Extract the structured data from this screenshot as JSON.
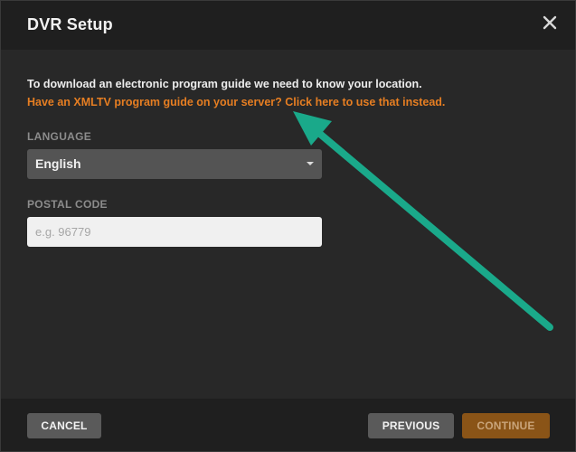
{
  "dialog": {
    "title": "DVR Setup",
    "close_icon": "close-x-icon"
  },
  "body": {
    "intro_text": "To download an electronic program guide we need to know your location.",
    "xmltv_link_text": "Have an XMLTV program guide on your server? Click here to use that instead."
  },
  "form": {
    "language": {
      "label": "LANGUAGE",
      "selected_value": "English",
      "icon": "dropdown-caret-icon"
    },
    "postal_code": {
      "label": "POSTAL CODE",
      "value": "",
      "placeholder": "e.g. 96779"
    }
  },
  "footer": {
    "cancel_label": "CANCEL",
    "previous_label": "PREVIOUS",
    "continue_label": "CONTINUE"
  },
  "colors": {
    "link": "#e67e22",
    "continue_button": "#8a5417",
    "arrow_annotation": "#1aa98a"
  }
}
